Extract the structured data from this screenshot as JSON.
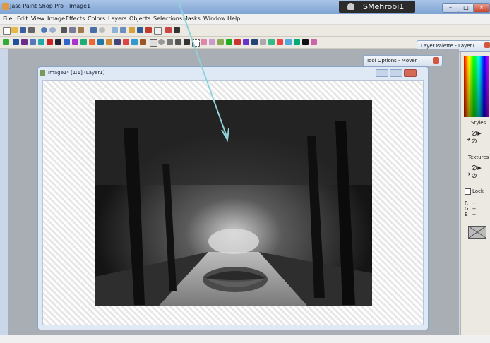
{
  "window": {
    "title": "Jasc Paint Shop Pro - Image1",
    "user": "SMehrobi1"
  },
  "menu": [
    "File",
    "Edit",
    "View",
    "Image",
    "Effects",
    "Colors",
    "Layers",
    "Objects",
    "Selections",
    "Masks",
    "Window",
    "Help"
  ],
  "image_window": {
    "title": "Image1* [1:1] (Layer1)"
  },
  "panels": {
    "tool_options": "Tool Options - Mover",
    "layer_palette": "Layer Palette - Layer1"
  },
  "palette": {
    "styles_label": "Styles",
    "textures_label": "Textures",
    "lock_label": "Lock",
    "rgb": [
      {
        "k": "R",
        "v": "--"
      },
      {
        "k": "G",
        "v": "--"
      },
      {
        "k": "B",
        "v": "--"
      }
    ]
  },
  "colors": {
    "accent": "#7fa3d4",
    "arrow": "#8fd3d9"
  }
}
